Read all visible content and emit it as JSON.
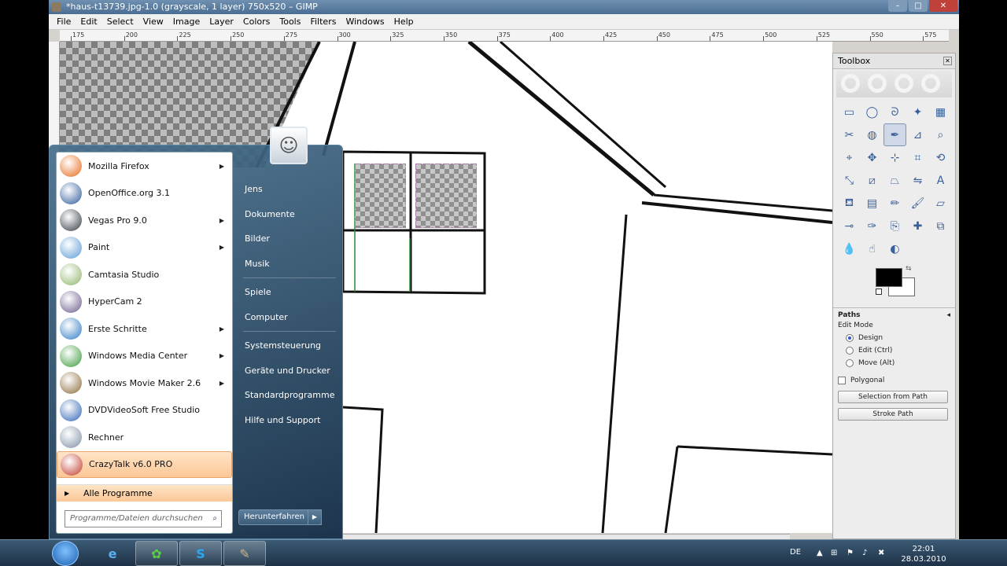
{
  "gimp": {
    "title": "*haus-t13739.jpg-1.0 (grayscale, 1 layer) 750x520 – GIMP",
    "menu": [
      "File",
      "Edit",
      "Select",
      "View",
      "Image",
      "Layer",
      "Colors",
      "Tools",
      "Filters",
      "Windows",
      "Help"
    ],
    "ruler_ticks": [
      "175",
      "200",
      "225",
      "250",
      "275",
      "300",
      "325",
      "350",
      "375",
      "400",
      "425",
      "450",
      "475",
      "500",
      "525",
      "550",
      "575"
    ]
  },
  "toolbox": {
    "title": "Toolbox",
    "tools": [
      "rect-select-icon",
      "ellipse-select-icon",
      "lasso-icon",
      "fuzzy-select-icon",
      "color-select-icon",
      "scissors-icon",
      "foreground-select-icon",
      "paths-icon",
      "color-picker-icon",
      "zoom-icon",
      "measure-icon",
      "move-icon",
      "align-icon",
      "crop-icon",
      "rotate-icon",
      "scale-icon",
      "shear-icon",
      "perspective-icon",
      "flip-icon",
      "text-icon",
      "bucket-fill-icon",
      "blend-icon",
      "pencil-icon",
      "paintbrush-icon",
      "eraser-icon",
      "airbrush-icon",
      "ink-icon",
      "clone-icon",
      "heal-icon",
      "perspective-clone-icon",
      "blur-icon",
      "smudge-icon",
      "dodge-burn-icon"
    ],
    "fg_color": "#000000",
    "bg_color": "#ffffff"
  },
  "paths": {
    "title": "Paths",
    "edit_mode": "Edit Mode",
    "modes": [
      "Design",
      "Edit (Ctrl)",
      "Move (Alt)"
    ],
    "polygonal": "Polygonal",
    "btn_selection": "Selection from Path",
    "btn_stroke": "Stroke Path"
  },
  "startmenu": {
    "apps": [
      {
        "label": "Mozilla Firefox",
        "arrow": true,
        "color": "#e66a1a"
      },
      {
        "label": "OpenOffice.org 3.1",
        "arrow": false,
        "color": "#2d5a9a"
      },
      {
        "label": "Vegas Pro 9.0",
        "arrow": true,
        "color": "#333a44"
      },
      {
        "label": "Paint",
        "arrow": true,
        "color": "#5a9ad6"
      },
      {
        "label": "Camtasia Studio",
        "arrow": false,
        "color": "#8fb56a"
      },
      {
        "label": "HyperCam 2",
        "arrow": false,
        "color": "#6a5a8a"
      },
      {
        "label": "Erste Schritte",
        "arrow": true,
        "color": "#2f7ac4"
      },
      {
        "label": "Windows Media Center",
        "arrow": true,
        "color": "#3a9a3a"
      },
      {
        "label": "Windows Movie Maker 2.6",
        "arrow": true,
        "color": "#8a6a3a"
      },
      {
        "label": "DVDVideoSoft Free Studio",
        "arrow": false,
        "color": "#2f63b5"
      },
      {
        "label": "Rechner",
        "arrow": false,
        "color": "#7d8fa5"
      },
      {
        "label": "CrazyTalk v6.0 PRO",
        "arrow": false,
        "color": "#c23a2a"
      }
    ],
    "all_programs": "Alle Programme",
    "search_placeholder": "Programme/Dateien durchsuchen",
    "right": [
      "Jens",
      "Dokumente",
      "Bilder",
      "Musik",
      "Spiele",
      "Computer",
      "Systemsteuerung",
      "Geräte und Drucker",
      "Standardprogramme",
      "Hilfe und Support"
    ],
    "shutdown": "Herunterfahren"
  },
  "taskbar": {
    "lang": "DE",
    "time": "22:01",
    "date": "28.03.2010"
  }
}
